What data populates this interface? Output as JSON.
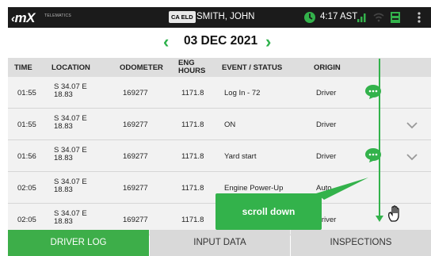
{
  "header": {
    "logo": "mX",
    "logo_sub": "TELEMATICS",
    "eld_badge": "CA ELD",
    "driver_name": "SMITH, JOHN",
    "time": "4:17 AST",
    "icons": [
      "clock-icon",
      "signal-icon",
      "wifi-icon",
      "printer-icon",
      "more-vert-icon"
    ],
    "accent_color": "#33b24b"
  },
  "datebar": {
    "prev": "‹",
    "date": "03 DEC 2021",
    "next": "›"
  },
  "table": {
    "columns": [
      "TIME",
      "LOCATION",
      "ODOMETER",
      "ENG\nHOURS",
      "EVENT / STATUS",
      "ORIGIN"
    ],
    "rows": [
      {
        "time": "01:55",
        "loc1": "S 34.07 E",
        "loc2": "18.83",
        "odometer": "169277",
        "eng_hours": "1171.8",
        "event": "Log In - 72",
        "origin": "Driver",
        "chat": true,
        "chevron": false
      },
      {
        "time": "01:55",
        "loc1": "S 34.07 E",
        "loc2": "18.83",
        "odometer": "169277",
        "eng_hours": "1171.8",
        "event": "ON",
        "origin": "Driver",
        "chat": false,
        "chevron": true
      },
      {
        "time": "01:56",
        "loc1": "S 34.07 E",
        "loc2": "18.83",
        "odometer": "169277",
        "eng_hours": "1171.8",
        "event": "Yard start",
        "origin": "Driver",
        "chat": true,
        "chevron": true
      },
      {
        "time": "02:05",
        "loc1": "S 34.07 E",
        "loc2": "18.83",
        "odometer": "169277",
        "eng_hours": "1171.8",
        "event": "Engine Power-Up",
        "origin": "Auto",
        "chat": false,
        "chevron": false
      },
      {
        "time": "02:05",
        "loc1": "S 34.07 E",
        "loc2": "18.83",
        "odometer": "169277",
        "eng_hours": "1171.8",
        "event": "",
        "origin": "Driver",
        "chat": false,
        "chevron": false
      }
    ]
  },
  "overlay": {
    "callout_text": "scroll down",
    "hand_icon": "hand-icon"
  },
  "tabs": [
    {
      "label": "DRIVER LOG",
      "active": true
    },
    {
      "label": "INPUT DATA",
      "active": false
    },
    {
      "label": "INSPECTIONS",
      "active": false
    }
  ]
}
